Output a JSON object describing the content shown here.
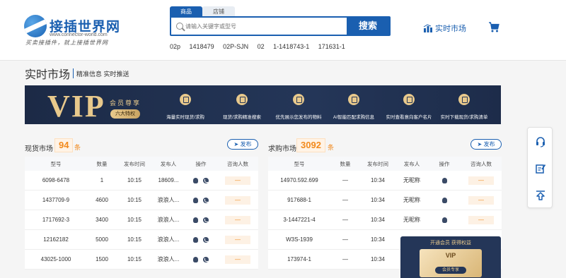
{
  "header": {
    "logo_title": "接插世界网",
    "logo_url": "www.connector-world.com",
    "logo_slogan": "买卖接插件，就上接插世界网",
    "search_tabs": [
      "商品",
      "店铺"
    ],
    "search_placeholder": "请输入关键字或型号",
    "search_button": "搜索",
    "hot_words": [
      "02p",
      "1418479",
      "02P-SJN",
      "02",
      "1-1418743-1",
      "171631-1"
    ],
    "market_link": "实时市场"
  },
  "page": {
    "title": "实时市场",
    "subtitle": "精准信息 实时推送"
  },
  "vip_banner": {
    "big_text": "VIP",
    "enjoy": "会员尊享",
    "badge": "六大特权",
    "features": [
      "海量实时现货/求购",
      "现货/求购精准搜索",
      "优先展示您发布的物料",
      "AI智能匹配求购信息",
      "实时查看意向客户名片",
      "实时下载现货/求购清单"
    ]
  },
  "stock": {
    "title": "现货市场",
    "count": "94",
    "unit": "条",
    "publish": "发布",
    "columns": [
      "型号",
      "数量",
      "发布时间",
      "发布人",
      "操作",
      "咨询人数"
    ],
    "rows": [
      [
        "6098-6478",
        "1",
        "10:15",
        "18609...",
        "—"
      ],
      [
        "1437709-9",
        "4600",
        "10:15",
        "浪浪人...",
        "—"
      ],
      [
        "1717692-3",
        "3400",
        "10:15",
        "浪浪人...",
        "—"
      ],
      [
        "12162182",
        "5000",
        "10:15",
        "浪浪人...",
        "—"
      ],
      [
        "43025-1000",
        "1500",
        "10:15",
        "浪浪人...",
        "—"
      ]
    ]
  },
  "demand": {
    "title": "求购市场",
    "count": "3092",
    "unit": "条",
    "publish": "发布",
    "columns": [
      "型号",
      "数量",
      "发布时间",
      "发布人",
      "操作",
      "咨询人数"
    ],
    "rows": [
      [
        "14970.592.699",
        "—",
        "10:34",
        "无昵称",
        "—"
      ],
      [
        "917688-1",
        "—",
        "10:34",
        "无昵称",
        "—"
      ],
      [
        "3-1447221-4",
        "—",
        "10:34",
        "无昵称",
        "—"
      ],
      [
        "W3S-1939",
        "—",
        "10:34",
        "",
        ""
      ],
      [
        "173974-1",
        "—",
        "10:34",
        "",
        ""
      ]
    ]
  },
  "vip_popup": {
    "title": "开通会员 获得权益",
    "card_vip": "VIP",
    "card_btn": "会员专享"
  },
  "colors": {
    "primary": "#1a5fb0",
    "accent": "#f28a1d",
    "vip_gold": "#e8c98c",
    "vip_navy": "#243658"
  }
}
